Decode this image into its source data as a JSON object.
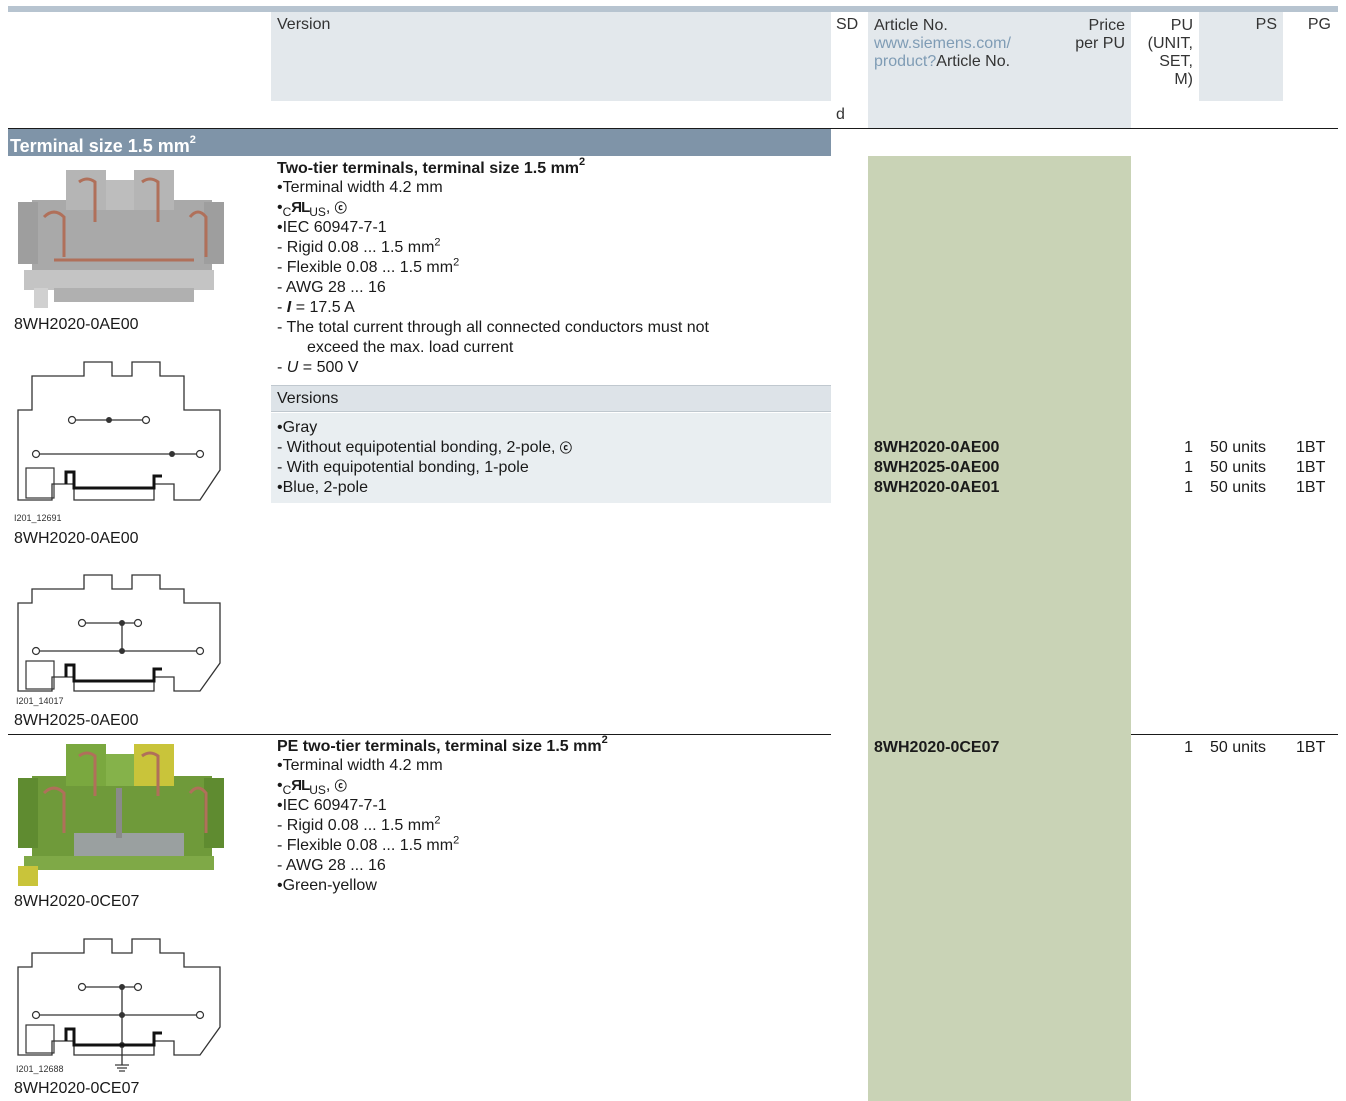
{
  "header": {
    "version": "Version",
    "sd": "SD",
    "sd_sub": "d",
    "article_no": "Article No.",
    "article_link": "www.siemens.com/",
    "article_link2": "product?",
    "article_link2_suffix": "Article No.",
    "price": "Price",
    "price2": "per PU",
    "pu": [
      "PU",
      "(UNIT,",
      "SET,",
      "M)"
    ],
    "ps": "PS",
    "pg": "PG"
  },
  "section": {
    "title": "Terminal size 1.5 mm",
    "title_sup": "2"
  },
  "group1": {
    "photo_caption": "8WH2020-0AE00",
    "diagram1_ref": "I201_12691",
    "diagram1_caption": "8WH2020-0AE00",
    "diagram2_ref": "I201_14017",
    "diagram2_caption": "8WH2025-0AE00",
    "title": "Two-tier terminals, terminal size 1.5 mm",
    "title_sup": "2",
    "spec": {
      "width": "Terminal width 4.2 mm",
      "cert_c": "C",
      "cert_us": "US",
      "iec": "IEC 60947-7-1",
      "rigid": "Rigid 0.08 ... 1.5 mm",
      "flexible": "Flexible 0.08 ... 1.5 mm",
      "awg": "AWG 28 ... 16",
      "current_sym": "I",
      "current": "= 17.5 A",
      "total1": "The total current through all connected conductors must not",
      "total2": "exceed the max. load current",
      "voltage_sym": "U",
      "voltage": "= 500 V"
    },
    "versions_label": "Versions",
    "versions": {
      "gray": "Gray",
      "without": "Without equipotential bonding, 2-pole,",
      "with": "With equipotential bonding, 1-pole",
      "blue": "Blue, 2-pole"
    },
    "rows": [
      {
        "article": "8WH2020-0AE00",
        "pu": "1",
        "ps": "50 units",
        "pg": "1BT"
      },
      {
        "article": "8WH2025-0AE00",
        "pu": "1",
        "ps": "50 units",
        "pg": "1BT"
      },
      {
        "article": "8WH2020-0AE01",
        "pu": "1",
        "ps": "50 units",
        "pg": "1BT"
      }
    ]
  },
  "group2": {
    "photo_caption": "8WH2020-0CE07",
    "diagram_ref": "I201_12688",
    "diagram_caption": "8WH2020-0CE07",
    "title": "PE two-tier terminals, terminal size 1.5 mm",
    "title_sup": "2",
    "spec": {
      "width": "Terminal width 4.2 mm",
      "cert_c": "C",
      "cert_us": "US",
      "iec": "IEC 60947-7-1",
      "rigid": "Rigid 0.08 ... 1.5 mm",
      "flexible": "Flexible 0.08 ... 1.5 mm",
      "awg": "AWG 28 ... 16",
      "color": "Green-yellow"
    },
    "row": {
      "article": "8WH2020-0CE07",
      "pu": "1",
      "ps": "50 units",
      "pg": "1BT"
    }
  },
  "sup2": "2",
  "colors": {
    "section": "#7f94a8",
    "article_col": "#c9d3b6",
    "header_bg": "#e3e8ec",
    "link": "#7f9cb5"
  }
}
